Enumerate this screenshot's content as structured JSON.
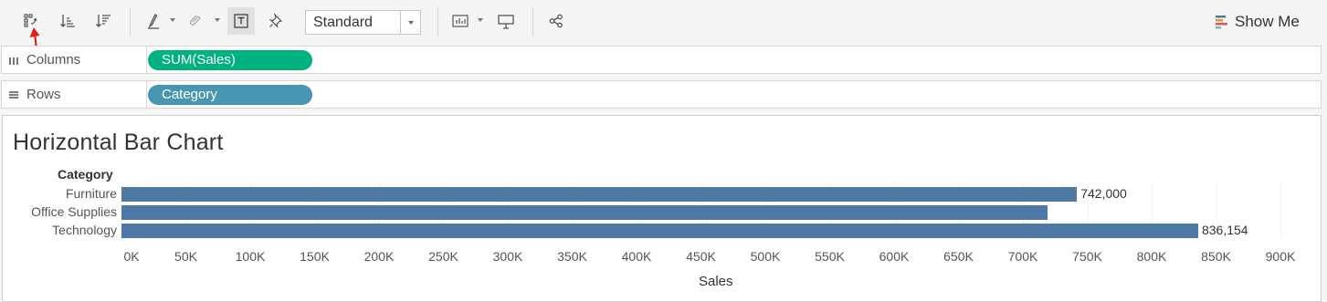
{
  "toolbar": {
    "items": [
      "swap-rows-columns-icon",
      "sort-ascending-icon",
      "sort-descending-icon",
      "highlight-icon",
      "group-icon",
      "show-labels-icon",
      "pin-icon",
      "bar-chart-icon",
      "presentation-icon",
      "share-icon"
    ],
    "fit_select": "Standard",
    "show_me": "Show Me"
  },
  "shelves": {
    "columns": {
      "label": "Columns",
      "pill": "SUM(Sales)"
    },
    "rows": {
      "label": "Rows",
      "pill": "Category"
    }
  },
  "colors": {
    "bar": "#4e79a7",
    "columns_pill": "#00b180",
    "rows_pill": "#4996b2",
    "annotation_arrow": "#e0201b"
  },
  "chart_data": {
    "type": "bar",
    "orientation": "horizontal",
    "title": "Horizontal Bar Chart",
    "category_header": "Category",
    "categories": [
      "Furniture",
      "Office Supplies",
      "Technology"
    ],
    "values": [
      742000,
      719047,
      836154
    ],
    "data_labels": [
      "742,000",
      "",
      "836,154"
    ],
    "xlabel": "Sales",
    "xlim": [
      0,
      950000
    ],
    "x_ticks": [
      "0K",
      "50K",
      "100K",
      "150K",
      "200K",
      "250K",
      "300K",
      "350K",
      "400K",
      "450K",
      "500K",
      "550K",
      "600K",
      "650K",
      "700K",
      "750K",
      "800K",
      "850K",
      "900K"
    ]
  }
}
